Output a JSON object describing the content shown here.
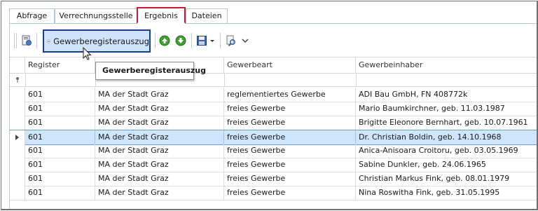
{
  "tabs": [
    {
      "label": "Abfrage",
      "active": false
    },
    {
      "label": "Verrechnungsstelle",
      "active": false
    },
    {
      "label": "Ergebnis",
      "active": true
    },
    {
      "label": "Dateien",
      "active": false
    }
  ],
  "toolbar": {
    "gewerbe_button_label": "Gewerberegisterauszug",
    "tooltip": "Gewerberegisterauszug",
    "icons": [
      "report-icon",
      "gewerbe-logo-icon",
      "move-up-icon",
      "move-down-icon",
      "save-icon",
      "dropdown-arrow-icon",
      "search-tool-icon",
      "chevron-down-icon"
    ]
  },
  "grid": {
    "columns": [
      "Register",
      "",
      "Gewerbeart",
      "Gewerbeinhaber"
    ],
    "rows": [
      {
        "register": "601",
        "behoerde": "MA der Stadt Graz",
        "gewerbeart": "reglementiertes Gewerbe",
        "inhaber": "ADI Bau GmbH, FN 408772k",
        "selected": false
      },
      {
        "register": "601",
        "behoerde": "MA der Stadt Graz",
        "gewerbeart": "freies Gewerbe",
        "inhaber": "Mario Baumkirchner, geb. 11.03.1987",
        "selected": false
      },
      {
        "register": "601",
        "behoerde": "MA der Stadt Graz",
        "gewerbeart": "freies Gewerbe",
        "inhaber": "Brigitte Eleonore Bernhart, geb. 10.07.1961",
        "selected": false
      },
      {
        "register": "601",
        "behoerde": "MA der Stadt Graz",
        "gewerbeart": "freies Gewerbe",
        "inhaber": "Dr. Christian Boldin, geb. 14.10.1968",
        "selected": true
      },
      {
        "register": "601",
        "behoerde": "MA der Stadt Graz",
        "gewerbeart": "freies Gewerbe",
        "inhaber": "Anica-Anisoara Croitoru, geb. 03.05.1969",
        "selected": false
      },
      {
        "register": "601",
        "behoerde": "MA der Stadt Graz",
        "gewerbeart": "freies Gewerbe",
        "inhaber": "Sabine Dunkler, geb. 24.06.1965",
        "selected": false
      },
      {
        "register": "601",
        "behoerde": "MA der Stadt Graz",
        "gewerbeart": "freies Gewerbe",
        "inhaber": "Christian Markus Fink, geb. 08.01.1979",
        "selected": false
      },
      {
        "register": "601",
        "behoerde": "MA der Stadt Graz",
        "gewerbeart": "freies Gewerbe",
        "inhaber": "Nina Roswitha Fink, geb. 31.05.1995",
        "selected": false
      }
    ]
  },
  "colors": {
    "active_tab_border": "#d3172c",
    "button_highlight_border": "#173c95",
    "selected_row": "#cfe5fb"
  }
}
